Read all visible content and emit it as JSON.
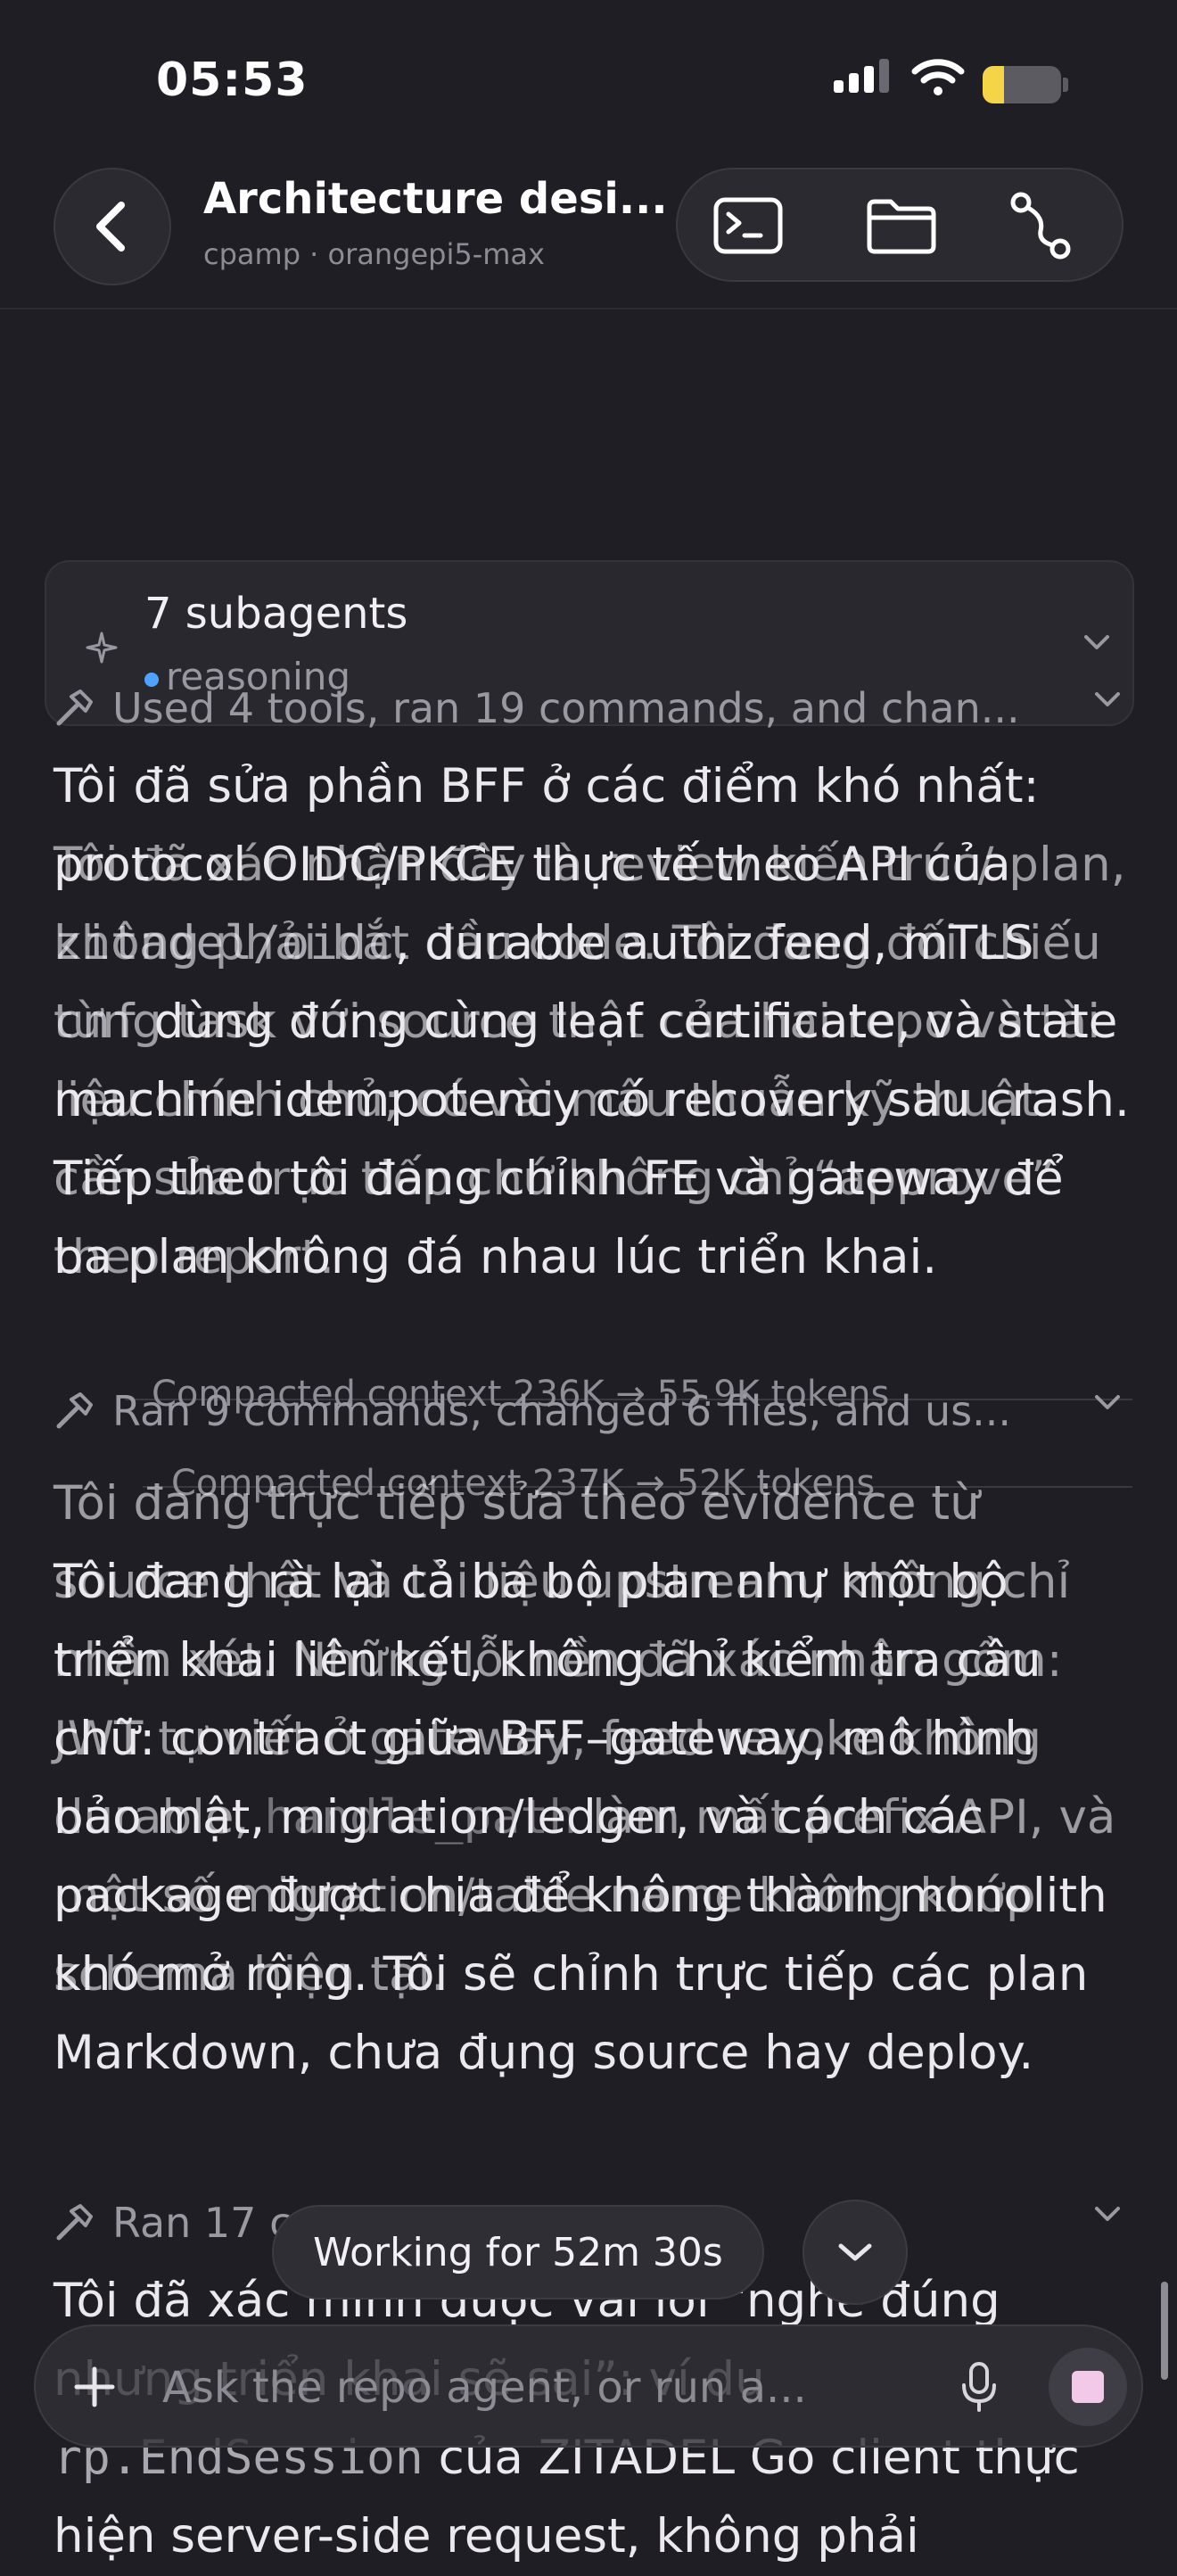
{
  "status_bar": {
    "time": "05:53",
    "battery_color": "#f5d547"
  },
  "header": {
    "title": "Architecture desi...",
    "subtitle": "cpamp · orangepi5-max"
  },
  "subagents": {
    "title": "7 subagents",
    "status": "reasoning",
    "status_color": "#4da3ff"
  },
  "tool_rows": [
    "Used 4 tools, ran 19 commands, and chan...",
    "Ran 9 commands, changed 6 files, and us...",
    "Ran 17 c"
  ],
  "compacted": [
    "Compacted context 236K → 55.9K tokens",
    "Compacted context 237K → 52K tokens"
  ],
  "messages": {
    "m1": "Tôi đã sửa phần BFF ở các điểm khó nhất: protocol OIDC/PKCE thực tế theo API của",
    "m1_code": "zitadel/oidc",
    "m1_rest": ", durable authz feed, mTLS",
    "m1_code2": "cnf",
    "m1_rest2": " dùng đúng cùng leaf certificate, và state machine idempotency có recovery sau crash. Tiếp theo tôi đang chỉnh FE và gateway để ba plan không đá nhau lúc triển khai.",
    "m2": "Tôi đã xác nhận đây là review kiến trúc/ plan, không phải bắt đầu code. Tôi đang đối chiếu từng task với source thật của hai repo và tài liệu chính chủ; có vài mâu thuẫn kỹ thuật cần sửa trực tiếp chứ không chỉ “approve” theo report.",
    "m3": "Tôi đang trực tiếp sửa theo evidence từ source thật và tài liệu upstream, không chỉ nhận xét. Những lỗi nền đã xác nhận gồm: JWT tự viết ở gateway, feed revoke không durable,",
    "m3_code": "handle_path",
    "m3_rest": " làm mất prefix API, và một số migration/table name không khớp schema hiện tại.",
    "m4": "Tôi đang rà lại cả ba bộ plan như một bộ triển khai liên kết, không chỉ kiểm tra câu chữ: contract giữa BFF–gateway, mô hình bảo mật, migration/ledger, và cách các package được chia để không thành monolith khó mở rộng. Tôi sẽ chỉnh trực tiếp các plan Markdown, chưa đụng source hay deploy.",
    "m5": "Tôi đã xác minh được vài lỗi “nghe đúng nhưng triển khai sẽ sai”: ví dụ",
    "m5_code": "rp.EndSession",
    "m5_rest": " của ZITADEL Go client thực hiện server-side request, không phải"
  },
  "working": {
    "label": "Working for 52m 30s"
  },
  "composer": {
    "placeholder": "Ask the repo agent, or run a..."
  }
}
